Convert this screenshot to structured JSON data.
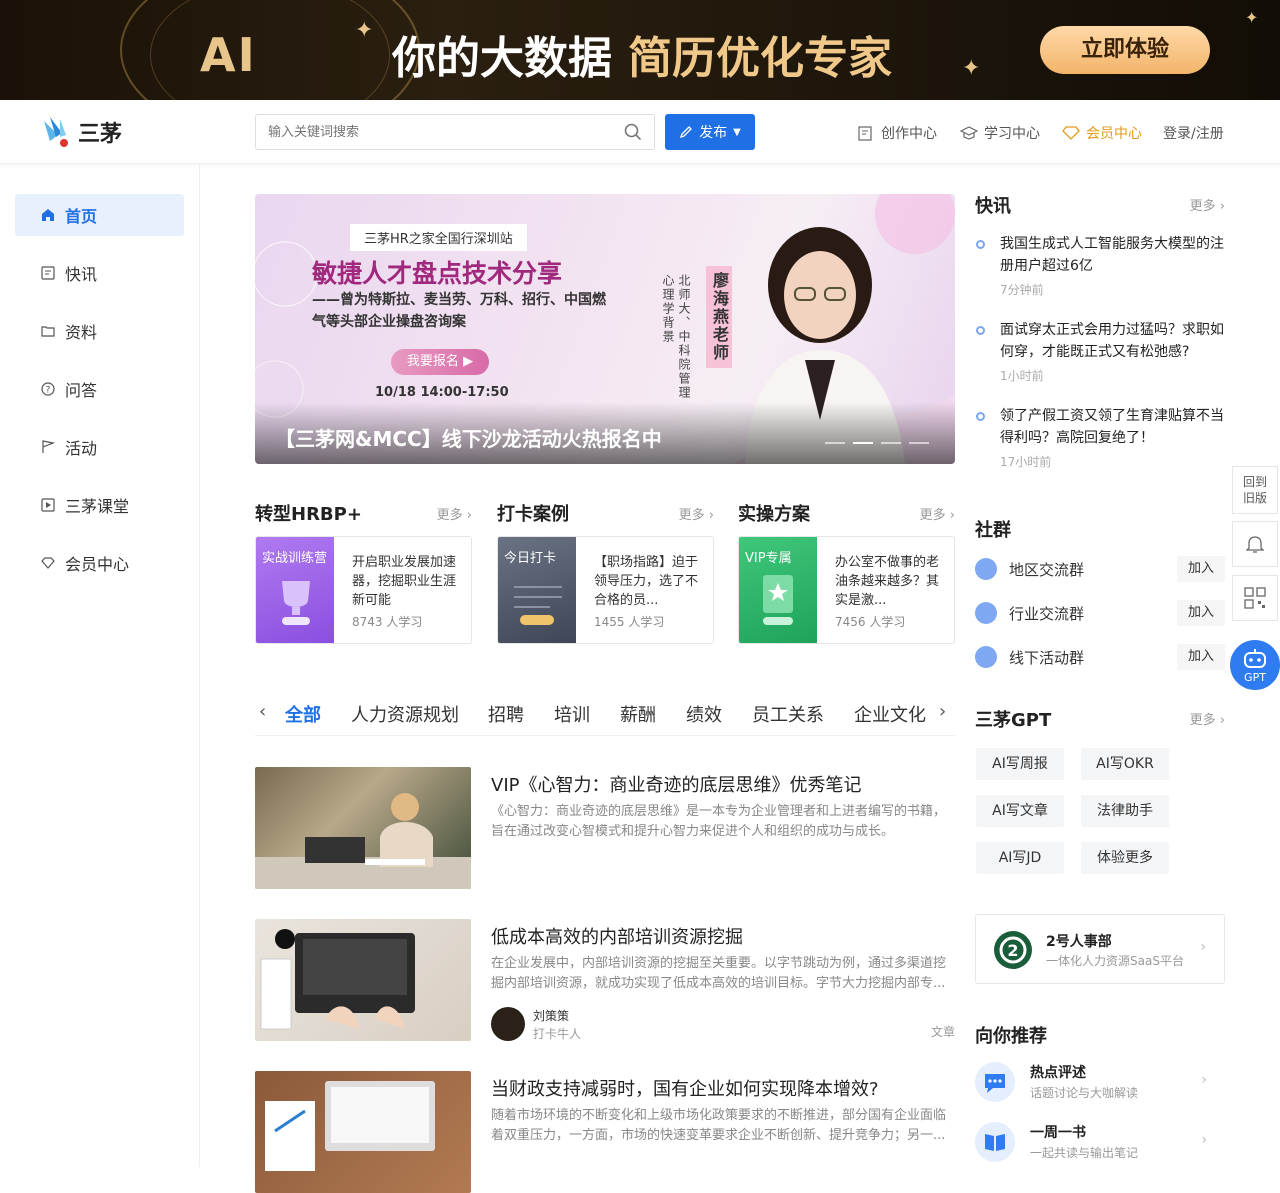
{
  "banner": {
    "ai": "AI",
    "title_white": "你的大数据",
    "title_gold": "简历优化专家",
    "cta": "立即体验"
  },
  "header": {
    "logo_text": "三茅",
    "search_placeholder": "输入关键词搜索",
    "publish": "发布",
    "nav": {
      "create": "创作中心",
      "learn": "学习中心",
      "vip": "会员中心",
      "login": "登录/注册"
    }
  },
  "sidebar": {
    "items": [
      {
        "label": "首页",
        "icon": "home-icon"
      },
      {
        "label": "快讯",
        "icon": "news-icon"
      },
      {
        "label": "资料",
        "icon": "folder-icon"
      },
      {
        "label": "问答",
        "icon": "question-icon"
      },
      {
        "label": "活动",
        "icon": "flag-icon"
      },
      {
        "label": "三茅课堂",
        "icon": "play-icon"
      },
      {
        "label": "会员中心",
        "icon": "diamond-icon"
      }
    ]
  },
  "hero": {
    "tag": "三茅HR之家全国行深圳站",
    "headline": "敏捷人才盘点技术分享",
    "subline": "——曾为特斯拉、麦当劳、万科、招行、中国燃气等头部企业操盘咨询案",
    "signup": "我要报名",
    "date": "10/18    14:00-17:50",
    "speaker": "廖海燕老师",
    "credential1": "北师大、中科院管理",
    "credential2": "心理学背景",
    "caption": "【三茅网&MCC】线下沙龙活动火热报名中"
  },
  "sections": [
    {
      "title": "转型HRBP+",
      "more": "更多 ›",
      "thumb_label": "实战训练营",
      "text": "开启职业发展加速器，挖掘职业生涯新可能",
      "count": "8743 人学习"
    },
    {
      "title": "打卡案例",
      "more": "更多 ›",
      "thumb_label": "今日打卡",
      "text": "【职场指路】迫于领导压力，选了不合格的员...",
      "count": "1455 人学习"
    },
    {
      "title": "实操方案",
      "more": "更多 ›",
      "thumb_label": "VIP专属",
      "text": "办公室不做事的老油条越来越多？其实是激...",
      "count": "7456 人学习"
    }
  ],
  "tabs": [
    "全部",
    "人力资源规划",
    "招聘",
    "培训",
    "薪酬",
    "绩效",
    "员工关系",
    "企业文化"
  ],
  "articles": [
    {
      "title": "VIP《心智力：商业奇迹的底层思维》优秀笔记",
      "desc": "《心智力：商业奇迹的底层思维》是一本专为企业管理者和上进者编写的书籍，旨在通过改变心智模式和提升心智力来促进个人和组织的成功与成长。",
      "author": "",
      "role": "",
      "kind": ""
    },
    {
      "title": "低成本高效的内部培训资源挖掘",
      "desc": "在企业发展中，内部培训资源的挖掘至关重要。以字节跳动为例，通过多渠道挖掘内部培训资源，就成功实现了低成本高效的培训目标。字节大力挖掘内部专...",
      "author": "刘策策",
      "role": "打卡牛人",
      "kind": "文章"
    },
    {
      "title": "当财政支持减弱时，国有企业如何实现降本增效?",
      "desc": "随着市场环境的不断变化和上级市场化政策要求的不断推进，部分国有企业面临着双重压力，一方面，市场的快速变革要求企业不断创新、提升竞争力；另一...",
      "author": "",
      "role": "",
      "kind": ""
    }
  ],
  "news": {
    "title": "快讯",
    "more": "更多 ›",
    "items": [
      {
        "text": "我国生成式人工智能服务大模型的注册用户超过6亿",
        "time": "7分钟前"
      },
      {
        "text": "面试穿太正式会用力过猛吗？求职如何穿，才能既正式又有松弛感?",
        "time": "1小时前"
      },
      {
        "text": "领了产假工资又领了生育津贴算不当得利吗？高院回复绝了！",
        "time": "17小时前"
      }
    ]
  },
  "community": {
    "title": "社群",
    "groups": [
      {
        "name": "地区交流群",
        "join": "加入"
      },
      {
        "name": "行业交流群",
        "join": "加入"
      },
      {
        "name": "线下活动群",
        "join": "加入"
      }
    ]
  },
  "gpt": {
    "title": "三茅GPT",
    "more": "更多 ›",
    "buttons": [
      "AI写周报",
      "AI写OKR",
      "AI写文章",
      "法律助手",
      "AI写JD",
      "体验更多"
    ]
  },
  "promo": {
    "title": "2号人事部",
    "sub": "一体化人力资源SaaS平台"
  },
  "recommend": {
    "title": "向你推荐",
    "items": [
      {
        "title": "热点评述",
        "sub": "话题讨论与大咖解读"
      },
      {
        "title": "一周一书",
        "sub": "一起共读与输出笔记"
      }
    ]
  },
  "floating": {
    "old": "回到旧版",
    "gpt": "GPT"
  }
}
